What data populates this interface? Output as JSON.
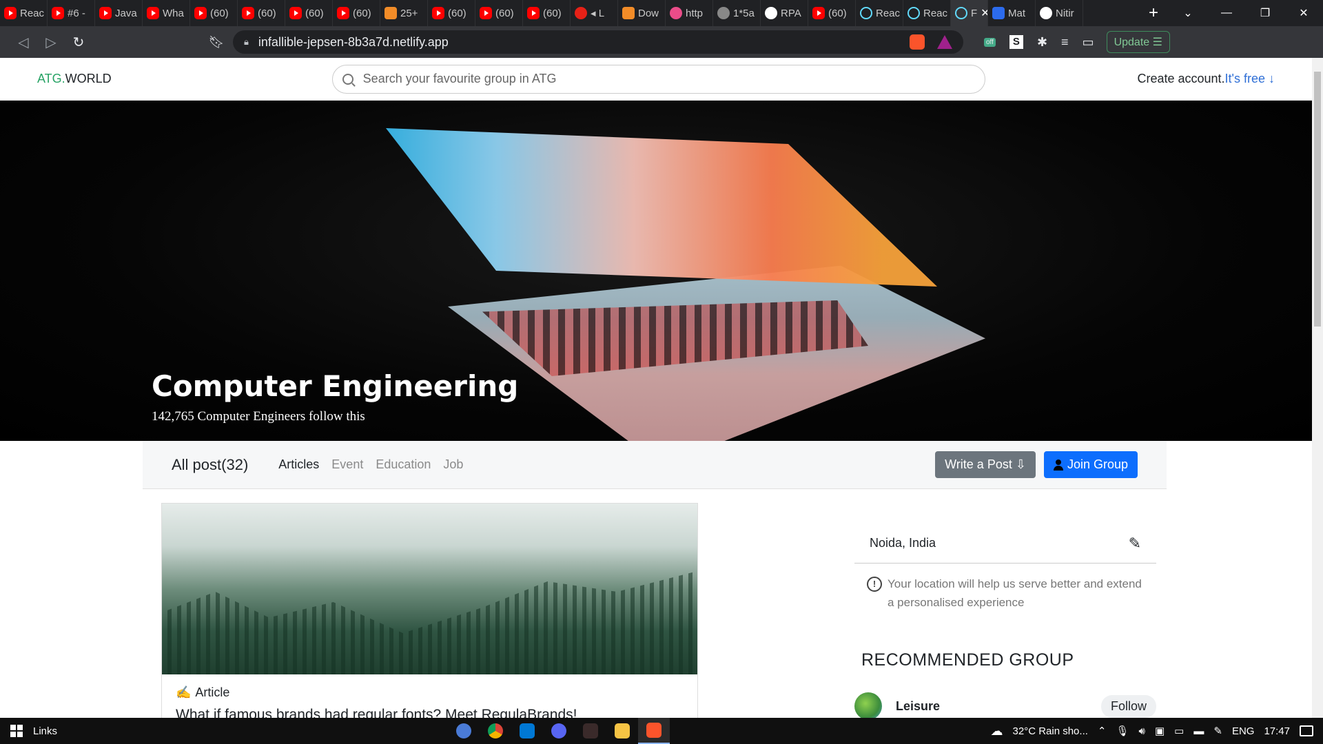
{
  "browser": {
    "tabs": [
      {
        "icon": "youtube-icon",
        "label": "Reac",
        "fav": "yt"
      },
      {
        "icon": "youtube-icon",
        "label": "#6 -",
        "fav": "yt"
      },
      {
        "icon": "youtube-icon",
        "label": "Java",
        "fav": "yt"
      },
      {
        "icon": "youtube-icon",
        "label": "Wha",
        "fav": "yt"
      },
      {
        "icon": "youtube-icon",
        "label": "(60)",
        "fav": "yt"
      },
      {
        "icon": "youtube-icon",
        "label": "(60)",
        "fav": "yt"
      },
      {
        "icon": "youtube-icon",
        "label": "(60)",
        "fav": "yt"
      },
      {
        "icon": "youtube-icon",
        "label": "(60)",
        "fav": "yt"
      },
      {
        "icon": "orange-app-icon",
        "label": "25+",
        "fav": "orange"
      },
      {
        "icon": "youtube-icon",
        "label": "(60)",
        "fav": "yt"
      },
      {
        "icon": "youtube-icon",
        "label": "(60)",
        "fav": "yt"
      },
      {
        "icon": "youtube-icon",
        "label": "(60)",
        "fav": "yt"
      },
      {
        "icon": "youtube-music-icon",
        "label": "◂ L",
        "fav": "redplay"
      },
      {
        "icon": "download-site-icon",
        "label": "Dow",
        "fav": "orange"
      },
      {
        "icon": "dribbble-icon",
        "label": "http",
        "fav": "dribbble"
      },
      {
        "icon": "globe-icon",
        "label": "1*5a",
        "fav": "globe"
      },
      {
        "icon": "github-icon",
        "label": "RPA",
        "fav": "gh"
      },
      {
        "icon": "youtube-icon",
        "label": "(60)",
        "fav": "yt"
      },
      {
        "icon": "react-icon",
        "label": "Reac",
        "fav": "react"
      },
      {
        "icon": "react-icon",
        "label": "Reac",
        "fav": "react"
      },
      {
        "icon": "react-icon",
        "label": "F",
        "fav": "react",
        "active": true
      },
      {
        "icon": "mui-icon",
        "label": "Mat",
        "fav": "blue"
      },
      {
        "icon": "github-icon",
        "label": "Nitir",
        "fav": "gh"
      }
    ],
    "url": "infallible-jepsen-8b3a7d.netlify.app",
    "update_label": "Update",
    "update_menu": "☰",
    "off_badge": "off"
  },
  "site": {
    "logo_main": "ATG.",
    "logo_rest": "WORLD",
    "search_placeholder": "Search your favourite group in ATG",
    "create_account": "Create account.",
    "create_free": "It's free ↓"
  },
  "hero": {
    "title": "Computer Engineering",
    "subtitle": "142,765 Computer Engineers follow this"
  },
  "filter": {
    "all_post": "All post(32)",
    "tabs": [
      "Articles",
      "Event",
      "Education",
      "Job"
    ],
    "write_post": "Write a Post ⇩",
    "join_group": "Join Group"
  },
  "post": {
    "type": "Article",
    "type_icon": "✍",
    "title": "What if famous brands had regular fonts? Meet RegulaBrands!"
  },
  "sidebar": {
    "location": "Noida, India",
    "location_info": "Your location will help us serve better and extend a personalised experience",
    "recommended_title": "RECOMMENDED GROUP",
    "groups": [
      {
        "name": "Leisure",
        "follow": "Follow"
      }
    ]
  },
  "taskbar": {
    "links": "Links",
    "weather": "32°C  Rain sho...",
    "language": "ENG",
    "time": "17:47"
  }
}
